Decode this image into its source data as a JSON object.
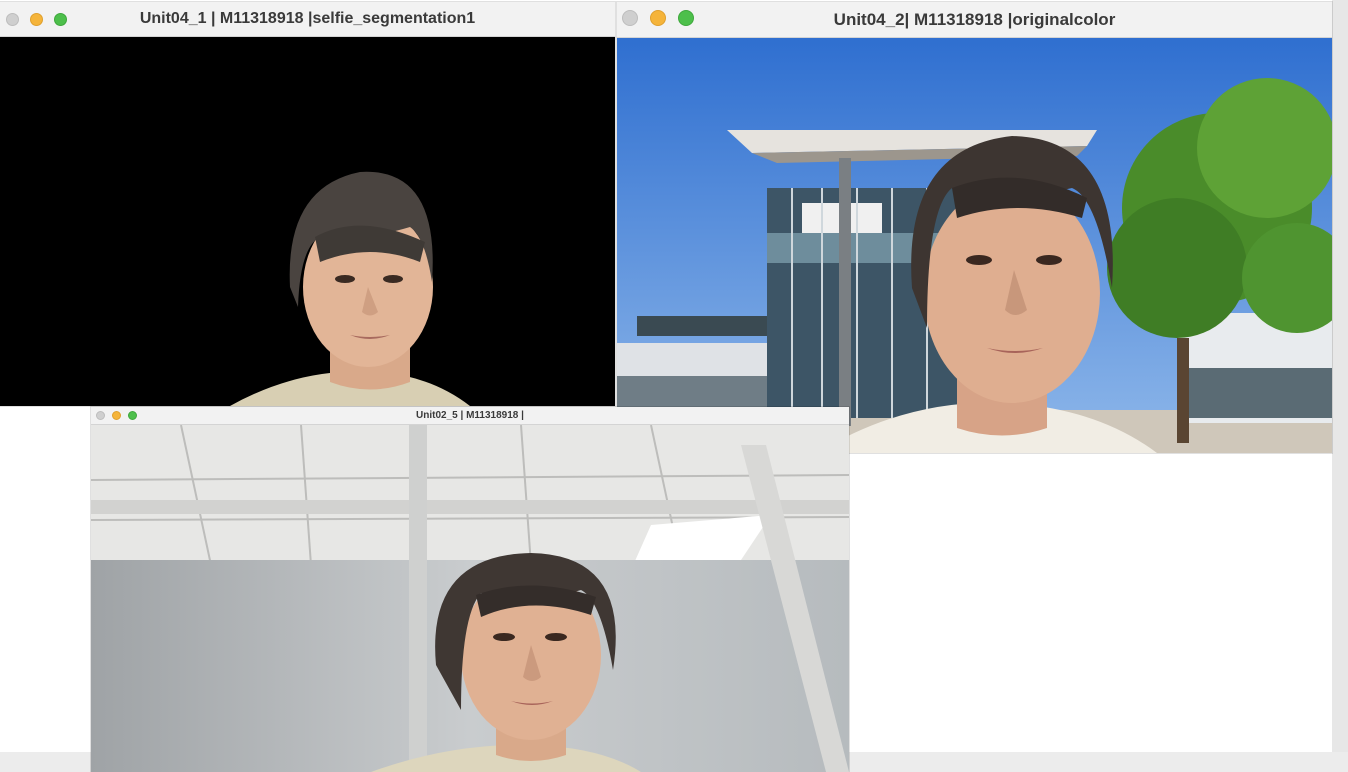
{
  "windows": {
    "segmentation": {
      "title": "Unit04_1 | M11318918 |selfie_segmentation1"
    },
    "original": {
      "title": "Unit04_2| M11318918 |originalcolor"
    },
    "camera": {
      "title": "Unit02_5 | M11318918 |"
    }
  },
  "colors": {
    "traffic_close": "#cfcfcf",
    "traffic_minimize": "#f5b43a",
    "traffic_maximize": "#4dbf4b",
    "segmentation_background": "#000000",
    "sky": "#4d86d8"
  },
  "icons": [
    "close-dot-icon",
    "minimize-dot-icon",
    "maximize-dot-icon"
  ]
}
